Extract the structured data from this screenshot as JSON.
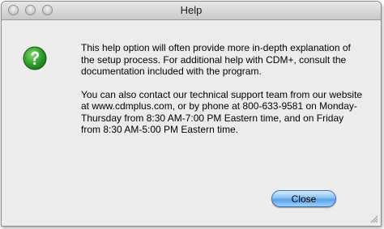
{
  "window": {
    "title": "Help"
  },
  "dialog": {
    "icon": "question-mark-icon",
    "paragraph1": "This help option will often provide more in-depth explanation of the setup process. For additional help with CDM+, consult the documentation included with the program.",
    "paragraph2": "You can also contact our technical support team from our website at www.cdmplus.com, or by phone at 800-633-9581 on Monday-Thursday from 8:30 AM-7:00 PM Eastern time, and on Friday from 8:30 AM-5:00 PM Eastern time.",
    "close_label": "Close"
  },
  "colors": {
    "icon_green": "#2f9e2f",
    "button_blue": "#6aaef0"
  }
}
